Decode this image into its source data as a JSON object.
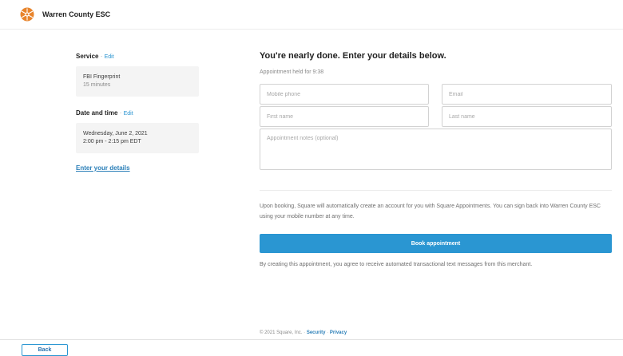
{
  "header": {
    "brand": "Warren County ESC",
    "logo_icon": "flower-logo-icon",
    "accent": "#e8842c"
  },
  "sidebar": {
    "service": {
      "title": "Service",
      "sep": " · ",
      "edit": "Edit",
      "name": "FBI Fingerprint",
      "duration": "15 minutes"
    },
    "datetime": {
      "title": "Date and time",
      "sep": " · ",
      "edit": "Edit",
      "date": "Wednesday, June 2, 2021",
      "time": "2:00 pm - 2:15 pm EDT"
    },
    "enter_details": "Enter your details"
  },
  "main": {
    "title": "You're nearly done. Enter your details below.",
    "held": "Appointment held for 9:38",
    "fields": {
      "mobile": "Mobile phone",
      "email": "Email",
      "first": "First name",
      "last": "Last name",
      "notes": "Appointment notes (optional)"
    },
    "notice": "Upon booking, Square will automatically create an account for you with Square Appointments. You can sign back into Warren County ESC using your mobile number at any time.",
    "book_button": "Book appointment",
    "consent": "By creating this appointment, you agree to receive automated transactional text messages from this merchant."
  },
  "footer": {
    "copyright": "© 2021 Square, Inc.",
    "sep": " · ",
    "security": "Security",
    "privacy": "Privacy"
  },
  "back_button": "Back",
  "colors": {
    "primary": "#2a96d2",
    "link": "#2b7fb8"
  }
}
